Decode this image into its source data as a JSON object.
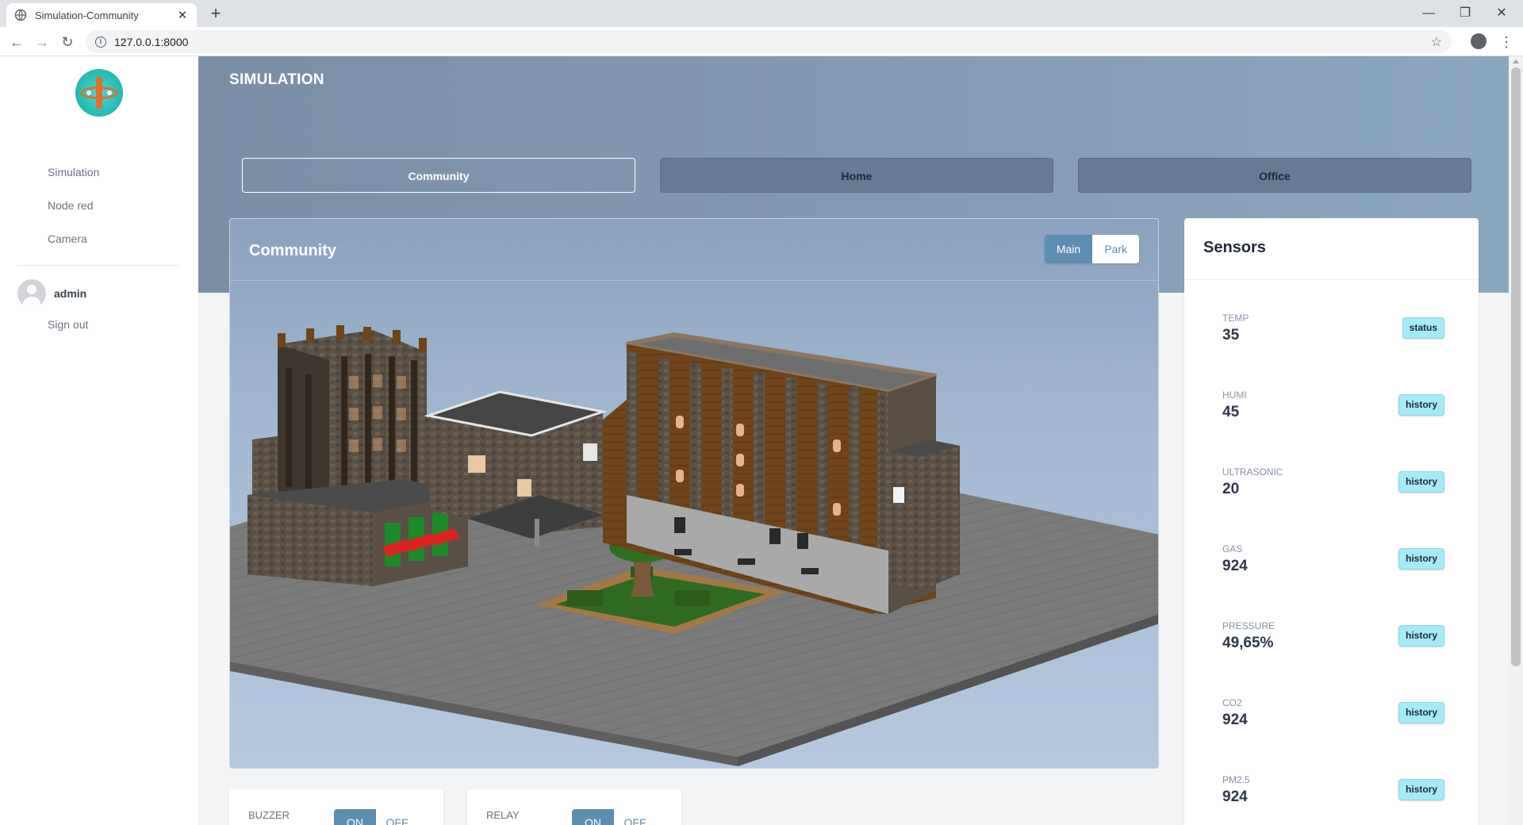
{
  "browser": {
    "tab_title": "Simulation-Community",
    "tab_close": "✕",
    "new_tab": "+",
    "url": "127.0.0.1:8000",
    "win_min": "—",
    "win_max": "❐",
    "win_close": "✕"
  },
  "sidebar": {
    "items": [
      {
        "label": "Simulation"
      },
      {
        "label": "Node red"
      },
      {
        "label": "Camera"
      }
    ],
    "user": "admin",
    "signout": "Sign out"
  },
  "main": {
    "title": "SIMULATION",
    "tabs": [
      {
        "label": "Community",
        "active": true
      },
      {
        "label": "Home",
        "active": false
      },
      {
        "label": "Office",
        "active": false
      }
    ]
  },
  "scene": {
    "title": "Community",
    "views": [
      {
        "label": "Main",
        "active": true
      },
      {
        "label": "Park",
        "active": false
      }
    ]
  },
  "sensors": {
    "title": "Sensors",
    "items": [
      {
        "label": "TEMP",
        "value": "35",
        "button": "status"
      },
      {
        "label": "HUMI",
        "value": "45",
        "button": "history"
      },
      {
        "label": "ULTRASONIC",
        "value": "20",
        "button": "history"
      },
      {
        "label": "GAS",
        "value": "924",
        "button": "history"
      },
      {
        "label": "PRESSURE",
        "value": "49,65%",
        "button": "history"
      },
      {
        "label": "CO2",
        "value": "924",
        "button": "history"
      },
      {
        "label": "PM2.5",
        "value": "924",
        "button": "history"
      }
    ]
  },
  "controls": [
    {
      "label": "BUZZER",
      "on": "ON",
      "off": "OFF",
      "state": "on"
    },
    {
      "label": "RELAY",
      "on": "ON",
      "off": "OFF",
      "state": "on"
    }
  ],
  "colors": {
    "accent": "#5e8eb0",
    "badge": "#a5eaf7",
    "banner_start": "#7a8ea6",
    "banner_end": "#8aa6be"
  }
}
